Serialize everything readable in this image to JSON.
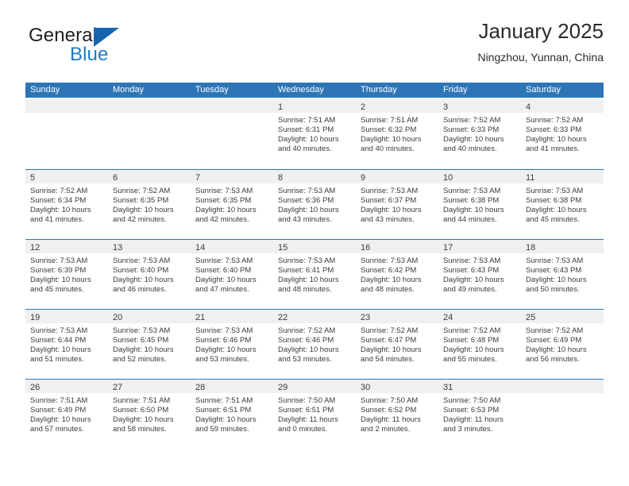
{
  "brand": {
    "name_part1": "General",
    "name_part2": "Blue",
    "logo_icon": "triangle-logo-icon"
  },
  "header": {
    "title": "January 2025",
    "location": "Ningzhou, Yunnan, China"
  },
  "calendar": {
    "weekdays": [
      "Sunday",
      "Monday",
      "Tuesday",
      "Wednesday",
      "Thursday",
      "Friday",
      "Saturday"
    ],
    "header_bg": "#2e75b6",
    "day_band_bg": "#f0f0f0",
    "weeks": [
      [
        {
          "day": "",
          "sunrise": "",
          "sunset": "",
          "daylight_line1": "",
          "daylight_line2": ""
        },
        {
          "day": "",
          "sunrise": "",
          "sunset": "",
          "daylight_line1": "",
          "daylight_line2": ""
        },
        {
          "day": "",
          "sunrise": "",
          "sunset": "",
          "daylight_line1": "",
          "daylight_line2": ""
        },
        {
          "day": "1",
          "sunrise": "Sunrise: 7:51 AM",
          "sunset": "Sunset: 6:31 PM",
          "daylight_line1": "Daylight: 10 hours",
          "daylight_line2": "and 40 minutes."
        },
        {
          "day": "2",
          "sunrise": "Sunrise: 7:51 AM",
          "sunset": "Sunset: 6:32 PM",
          "daylight_line1": "Daylight: 10 hours",
          "daylight_line2": "and 40 minutes."
        },
        {
          "day": "3",
          "sunrise": "Sunrise: 7:52 AM",
          "sunset": "Sunset: 6:33 PM",
          "daylight_line1": "Daylight: 10 hours",
          "daylight_line2": "and 40 minutes."
        },
        {
          "day": "4",
          "sunrise": "Sunrise: 7:52 AM",
          "sunset": "Sunset: 6:33 PM",
          "daylight_line1": "Daylight: 10 hours",
          "daylight_line2": "and 41 minutes."
        }
      ],
      [
        {
          "day": "5",
          "sunrise": "Sunrise: 7:52 AM",
          "sunset": "Sunset: 6:34 PM",
          "daylight_line1": "Daylight: 10 hours",
          "daylight_line2": "and 41 minutes."
        },
        {
          "day": "6",
          "sunrise": "Sunrise: 7:52 AM",
          "sunset": "Sunset: 6:35 PM",
          "daylight_line1": "Daylight: 10 hours",
          "daylight_line2": "and 42 minutes."
        },
        {
          "day": "7",
          "sunrise": "Sunrise: 7:53 AM",
          "sunset": "Sunset: 6:35 PM",
          "daylight_line1": "Daylight: 10 hours",
          "daylight_line2": "and 42 minutes."
        },
        {
          "day": "8",
          "sunrise": "Sunrise: 7:53 AM",
          "sunset": "Sunset: 6:36 PM",
          "daylight_line1": "Daylight: 10 hours",
          "daylight_line2": "and 43 minutes."
        },
        {
          "day": "9",
          "sunrise": "Sunrise: 7:53 AM",
          "sunset": "Sunset: 6:37 PM",
          "daylight_line1": "Daylight: 10 hours",
          "daylight_line2": "and 43 minutes."
        },
        {
          "day": "10",
          "sunrise": "Sunrise: 7:53 AM",
          "sunset": "Sunset: 6:38 PM",
          "daylight_line1": "Daylight: 10 hours",
          "daylight_line2": "and 44 minutes."
        },
        {
          "day": "11",
          "sunrise": "Sunrise: 7:53 AM",
          "sunset": "Sunset: 6:38 PM",
          "daylight_line1": "Daylight: 10 hours",
          "daylight_line2": "and 45 minutes."
        }
      ],
      [
        {
          "day": "12",
          "sunrise": "Sunrise: 7:53 AM",
          "sunset": "Sunset: 6:39 PM",
          "daylight_line1": "Daylight: 10 hours",
          "daylight_line2": "and 45 minutes."
        },
        {
          "day": "13",
          "sunrise": "Sunrise: 7:53 AM",
          "sunset": "Sunset: 6:40 PM",
          "daylight_line1": "Daylight: 10 hours",
          "daylight_line2": "and 46 minutes."
        },
        {
          "day": "14",
          "sunrise": "Sunrise: 7:53 AM",
          "sunset": "Sunset: 6:40 PM",
          "daylight_line1": "Daylight: 10 hours",
          "daylight_line2": "and 47 minutes."
        },
        {
          "day": "15",
          "sunrise": "Sunrise: 7:53 AM",
          "sunset": "Sunset: 6:41 PM",
          "daylight_line1": "Daylight: 10 hours",
          "daylight_line2": "and 48 minutes."
        },
        {
          "day": "16",
          "sunrise": "Sunrise: 7:53 AM",
          "sunset": "Sunset: 6:42 PM",
          "daylight_line1": "Daylight: 10 hours",
          "daylight_line2": "and 48 minutes."
        },
        {
          "day": "17",
          "sunrise": "Sunrise: 7:53 AM",
          "sunset": "Sunset: 6:43 PM",
          "daylight_line1": "Daylight: 10 hours",
          "daylight_line2": "and 49 minutes."
        },
        {
          "day": "18",
          "sunrise": "Sunrise: 7:53 AM",
          "sunset": "Sunset: 6:43 PM",
          "daylight_line1": "Daylight: 10 hours",
          "daylight_line2": "and 50 minutes."
        }
      ],
      [
        {
          "day": "19",
          "sunrise": "Sunrise: 7:53 AM",
          "sunset": "Sunset: 6:44 PM",
          "daylight_line1": "Daylight: 10 hours",
          "daylight_line2": "and 51 minutes."
        },
        {
          "day": "20",
          "sunrise": "Sunrise: 7:53 AM",
          "sunset": "Sunset: 6:45 PM",
          "daylight_line1": "Daylight: 10 hours",
          "daylight_line2": "and 52 minutes."
        },
        {
          "day": "21",
          "sunrise": "Sunrise: 7:53 AM",
          "sunset": "Sunset: 6:46 PM",
          "daylight_line1": "Daylight: 10 hours",
          "daylight_line2": "and 53 minutes."
        },
        {
          "day": "22",
          "sunrise": "Sunrise: 7:52 AM",
          "sunset": "Sunset: 6:46 PM",
          "daylight_line1": "Daylight: 10 hours",
          "daylight_line2": "and 53 minutes."
        },
        {
          "day": "23",
          "sunrise": "Sunrise: 7:52 AM",
          "sunset": "Sunset: 6:47 PM",
          "daylight_line1": "Daylight: 10 hours",
          "daylight_line2": "and 54 minutes."
        },
        {
          "day": "24",
          "sunrise": "Sunrise: 7:52 AM",
          "sunset": "Sunset: 6:48 PM",
          "daylight_line1": "Daylight: 10 hours",
          "daylight_line2": "and 55 minutes."
        },
        {
          "day": "25",
          "sunrise": "Sunrise: 7:52 AM",
          "sunset": "Sunset: 6:49 PM",
          "daylight_line1": "Daylight: 10 hours",
          "daylight_line2": "and 56 minutes."
        }
      ],
      [
        {
          "day": "26",
          "sunrise": "Sunrise: 7:51 AM",
          "sunset": "Sunset: 6:49 PM",
          "daylight_line1": "Daylight: 10 hours",
          "daylight_line2": "and 57 minutes."
        },
        {
          "day": "27",
          "sunrise": "Sunrise: 7:51 AM",
          "sunset": "Sunset: 6:50 PM",
          "daylight_line1": "Daylight: 10 hours",
          "daylight_line2": "and 58 minutes."
        },
        {
          "day": "28",
          "sunrise": "Sunrise: 7:51 AM",
          "sunset": "Sunset: 6:51 PM",
          "daylight_line1": "Daylight: 10 hours",
          "daylight_line2": "and 59 minutes."
        },
        {
          "day": "29",
          "sunrise": "Sunrise: 7:50 AM",
          "sunset": "Sunset: 6:51 PM",
          "daylight_line1": "Daylight: 11 hours",
          "daylight_line2": "and 0 minutes."
        },
        {
          "day": "30",
          "sunrise": "Sunrise: 7:50 AM",
          "sunset": "Sunset: 6:52 PM",
          "daylight_line1": "Daylight: 11 hours",
          "daylight_line2": "and 2 minutes."
        },
        {
          "day": "31",
          "sunrise": "Sunrise: 7:50 AM",
          "sunset": "Sunset: 6:53 PM",
          "daylight_line1": "Daylight: 11 hours",
          "daylight_line2": "and 3 minutes."
        },
        {
          "day": "",
          "sunrise": "",
          "sunset": "",
          "daylight_line1": "",
          "daylight_line2": ""
        }
      ]
    ]
  }
}
